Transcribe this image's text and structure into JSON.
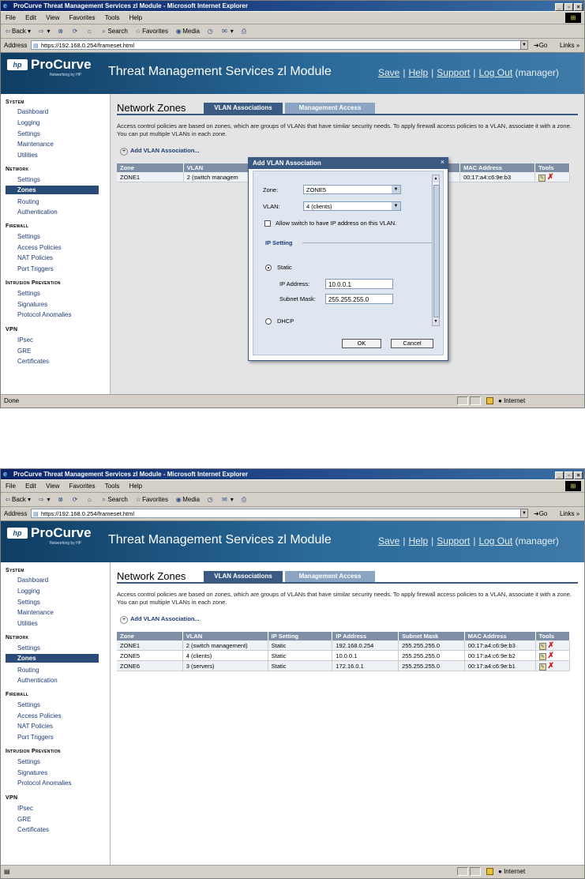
{
  "browser": {
    "window_title": "ProCurve Threat Management Services zl Module - Microsoft Internet Explorer",
    "menu": [
      "File",
      "Edit",
      "View",
      "Favorites",
      "Tools",
      "Help"
    ],
    "toolbar": {
      "back": "Back",
      "search": "Search",
      "favorites": "Favorites",
      "media": "Media"
    },
    "address_label": "Address",
    "address_url": "https://192.168.0.254/frameset.html",
    "go_label": "Go",
    "links_label": "Links »",
    "zone_label": "Internet"
  },
  "header": {
    "brand": "ProCurve",
    "brand_sub": "Networking by HP",
    "product": "Threat Management Services zl Module",
    "links": {
      "save": "Save",
      "help": "Help",
      "support": "Support",
      "logout": "Log Out",
      "user": "(manager)"
    }
  },
  "sidebar": {
    "system": {
      "title": "System",
      "items": [
        "Dashboard",
        "Logging",
        "Settings",
        "Maintenance",
        "Utilities"
      ]
    },
    "network": {
      "title": "Network",
      "items": [
        "Settings",
        "Zones",
        "Routing",
        "Authentication"
      ],
      "selected": "Zones"
    },
    "firewall": {
      "title": "Firewall",
      "items": [
        "Settings",
        "Access Policies",
        "NAT Policies",
        "Port Triggers"
      ]
    },
    "ips": {
      "title": "Intrusion Prevention",
      "items": [
        "Settings",
        "Signatures",
        "Protocol Anomalies"
      ]
    },
    "vpn": {
      "title": "VPN",
      "items": [
        "IPsec",
        "GRE",
        "Certificates"
      ]
    }
  },
  "main": {
    "title": "Network Zones",
    "tabs": [
      "VLAN Associations",
      "Management Access"
    ],
    "description": "Access control policies are based on zones, which are groups of VLANs that have similar security needs. To apply firewall access policies to a VLAN, associate it with a zone. You can put multiple VLANs in each zone.",
    "add_link": "Add VLAN Association..."
  },
  "shot1": {
    "status_text": "Done",
    "table": {
      "columns": [
        "Zone",
        "VLAN",
        "MAC Address",
        "Tools"
      ],
      "rows": [
        [
          "ZONE1",
          "2 (switch managem",
          "00:17:a4:c6:9e:b3"
        ]
      ]
    },
    "dialog": {
      "title": "Add VLAN Association",
      "close": "×",
      "zone_label": "Zone:",
      "zone_value": "ZONE5",
      "vlan_label": "VLAN:",
      "vlan_value": "4 (clients)",
      "allow_label": "Allow switch to have IP address on this VLAN.",
      "ip_setting": "IP Setting",
      "static_label": "Static",
      "ip_label": "IP Address:",
      "ip_value": "10.0.0.1",
      "mask_label": "Subnet Mask:",
      "mask_value": "255.255.255.0",
      "dhcp_label": "DHCP",
      "ok": "OK",
      "cancel": "Cancel"
    }
  },
  "shot2": {
    "status_text": "",
    "table": {
      "columns": [
        "Zone",
        "VLAN",
        "IP Setting",
        "IP Address",
        "Subnet Mask",
        "MAC Address",
        "Tools"
      ],
      "rows": [
        [
          "ZONE1",
          "2 (switch management)",
          "Static",
          "192.168.0.254",
          "255.255.255.0",
          "00:17:a4:c6:9e:b3"
        ],
        [
          "ZONE5",
          "4 (clients)",
          "Static",
          "10.0.0.1",
          "255.255.255.0",
          "00:17:a4:c6:9e:b2"
        ],
        [
          "ZONE6",
          "3 (servers)",
          "Static",
          "172.16.0.1",
          "255.255.255.0",
          "00:17:a4:c6:9e:b1"
        ]
      ]
    }
  }
}
